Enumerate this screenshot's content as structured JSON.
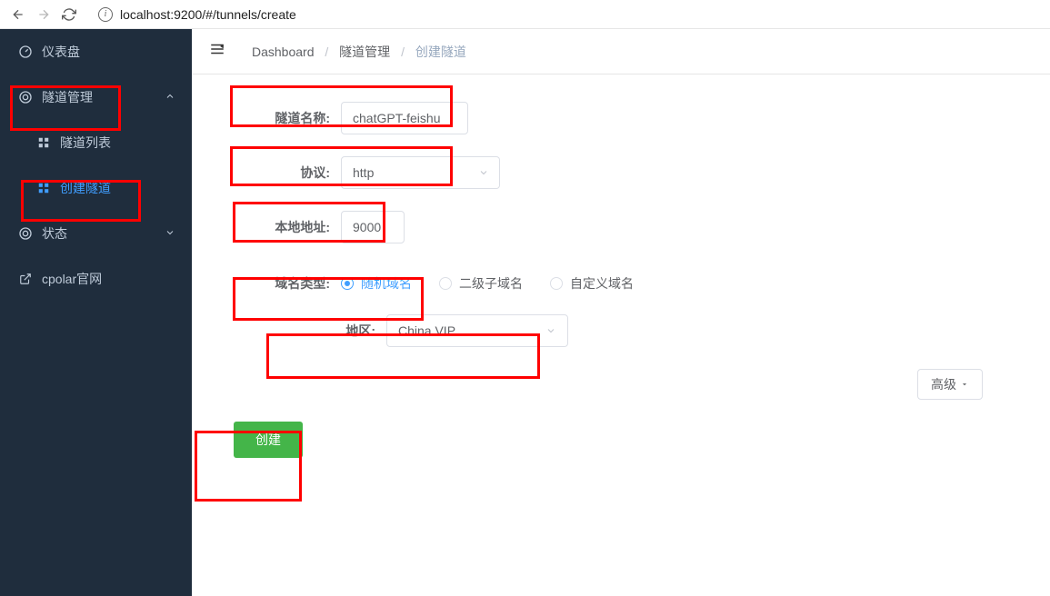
{
  "browser": {
    "url": "localhost:9200/#/tunnels/create"
  },
  "sidebar": {
    "items": [
      {
        "label": "仪表盘"
      },
      {
        "label": "隧道管理"
      },
      {
        "label": "隧道列表"
      },
      {
        "label": "创建隧道"
      },
      {
        "label": "状态"
      },
      {
        "label": "cpolar官网"
      }
    ]
  },
  "breadcrumb": {
    "root": "Dashboard",
    "mid": "隧道管理",
    "current": "创建隧道"
  },
  "form": {
    "tunnel_name_label": "隧道名称:",
    "tunnel_name_value": "chatGPT-feishu",
    "protocol_label": "协议:",
    "protocol_value": "http",
    "local_addr_label": "本地地址:",
    "local_addr_value": "9000",
    "domain_type_label": "域名类型:",
    "domain_types": [
      {
        "label": "随机域名",
        "checked": true
      },
      {
        "label": "二级子域名",
        "checked": false
      },
      {
        "label": "自定义域名",
        "checked": false
      }
    ],
    "region_label": "地区:",
    "region_value": "China VIP",
    "advanced_label": "高级",
    "submit_label": "创建"
  }
}
